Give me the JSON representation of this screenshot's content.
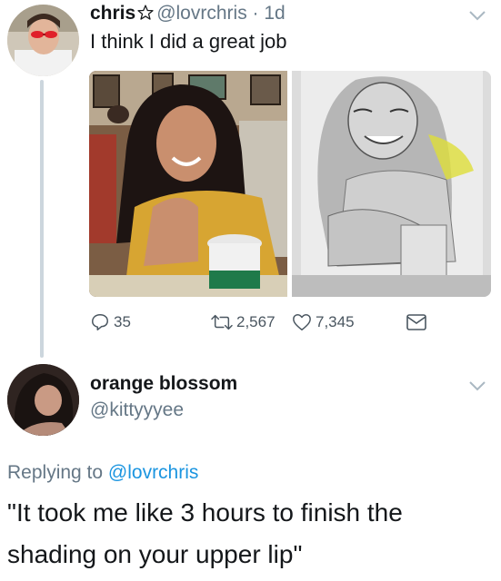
{
  "tweet1": {
    "display_name": "chris",
    "handle": "@lovrchris",
    "separator": " · ",
    "age": "1d",
    "text": "I think I did a great job",
    "stats": {
      "replies": "35",
      "retweets": "2,567",
      "likes": "7,345"
    }
  },
  "tweet2": {
    "display_name": "orange blossom",
    "handle": "@kittyyyee",
    "replying_prefix": "Replying to ",
    "replying_to": "@lovrchris",
    "text": "\"It took me like 3 hours to finish the shading on your upper lip\""
  },
  "icons": {
    "star": "star-icon",
    "reply": "reply-icon",
    "retweet": "retweet-icon",
    "like": "heart-icon",
    "dm": "envelope-icon",
    "chevron": "chevron-down-icon"
  },
  "colors": {
    "link": "#1b95e0",
    "muted": "#657786",
    "thread_line": "#ccd6dd"
  }
}
